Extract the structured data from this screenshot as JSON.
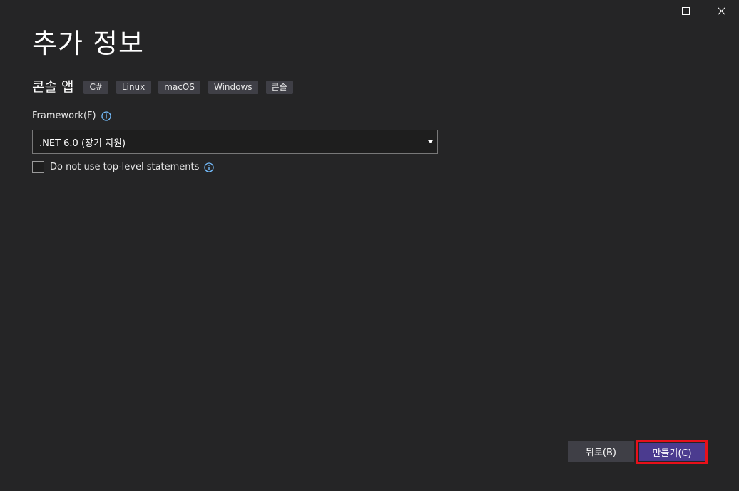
{
  "window": {
    "controls": [
      "minimize",
      "maximize",
      "close"
    ]
  },
  "header": {
    "title": "추가 정보"
  },
  "template": {
    "name": "콘솔 앱",
    "tags": [
      "C#",
      "Linux",
      "macOS",
      "Windows",
      "콘솔"
    ]
  },
  "framework": {
    "label": "Framework(F)",
    "selected": ".NET 6.0 (장기 지원)"
  },
  "options": {
    "top_level_label": "Do not use top-level statements",
    "top_level_checked": false
  },
  "footer": {
    "back_label": "뒤로(B)",
    "create_label": "만들기(C)"
  },
  "colors": {
    "background": "#252526",
    "accent_button": "#4b3b8f",
    "highlight_outline": "#e8101a",
    "info_icon": "#75beff"
  }
}
